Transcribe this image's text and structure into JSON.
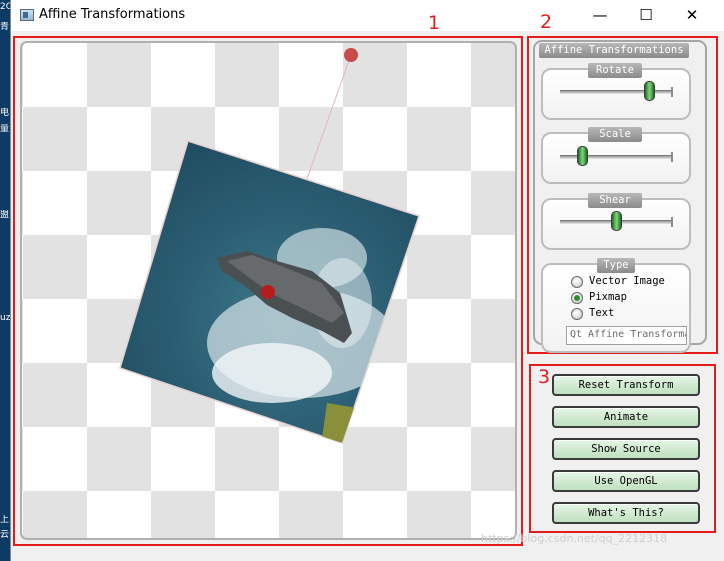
{
  "window": {
    "title": "Affine Transformations",
    "minimize_glyph": "—",
    "maximize_glyph": "☐",
    "close_glyph": "✕"
  },
  "desktop_strip": [
    "2C",
    "青",
    "电",
    "量",
    "盟",
    "uz",
    "上",
    "云"
  ],
  "canvas": {
    "image_name": "Pixmap",
    "control_points": 2
  },
  "annotations": [
    "1",
    "2",
    "3"
  ],
  "panel": {
    "title": "Affine Transformations",
    "rotate": {
      "label": "Rotate",
      "value": 0.85
    },
    "scale": {
      "label": "Scale",
      "value": 0.15
    },
    "shear": {
      "label": "Shear",
      "value": 0.5
    },
    "type": {
      "label": "Type",
      "options": [
        {
          "label": "Vector Image",
          "checked": false
        },
        {
          "label": "Pixmap",
          "checked": true
        },
        {
          "label": "Text",
          "checked": false
        }
      ],
      "text_value": "Qt Affine Transformation"
    }
  },
  "buttons": {
    "reset": "Reset Transform",
    "animate": "Animate",
    "show_source": "Show Source",
    "opengl": "Use OpenGL",
    "whats_this": "What's This?"
  },
  "watermark": "https://blog.csdn.net/qq_2212318"
}
